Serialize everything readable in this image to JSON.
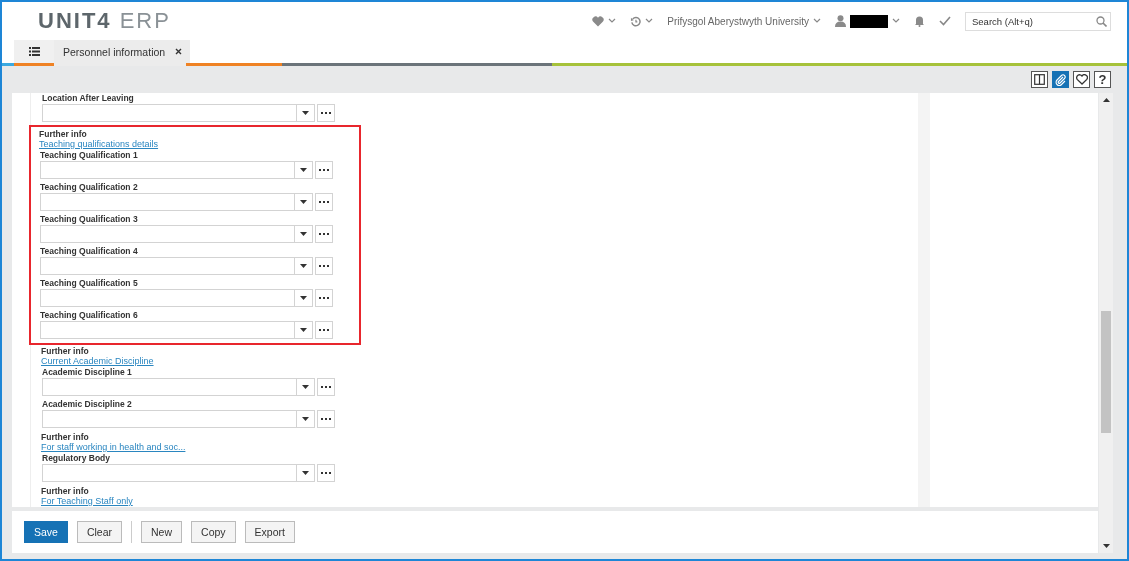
{
  "header": {
    "logo_brand": "UNIT4",
    "logo_product": "ERP",
    "organisation": "Prifysgol Aberystwyth University",
    "search": {
      "placeholder": "Search (Alt+q)"
    }
  },
  "tabs": [
    {
      "label": "Personnel information",
      "selected": true
    }
  ],
  "toolbar": [
    {
      "kind": "split",
      "selected": false
    },
    {
      "kind": "attach",
      "selected": true
    },
    {
      "kind": "favourite",
      "selected": false
    },
    {
      "kind": "help",
      "label": "?",
      "selected": false
    }
  ],
  "sections": [
    {
      "highlighted": false,
      "items": [
        {
          "kind": "field",
          "label": "Location After Leaving"
        }
      ]
    },
    {
      "highlighted": true,
      "items": [
        {
          "kind": "info",
          "title": "Further info",
          "link": "Teaching qualifications details"
        },
        {
          "kind": "field",
          "label": "Teaching Qualification 1"
        },
        {
          "kind": "field",
          "label": "Teaching Qualification 2"
        },
        {
          "kind": "field",
          "label": "Teaching Qualification 3"
        },
        {
          "kind": "field",
          "label": "Teaching Qualification 4"
        },
        {
          "kind": "field",
          "label": "Teaching Qualification 5"
        },
        {
          "kind": "field",
          "label": "Teaching Qualification 6"
        }
      ]
    },
    {
      "highlighted": false,
      "items": [
        {
          "kind": "info",
          "title": "Further info",
          "link": "Current Academic Discipline"
        },
        {
          "kind": "field",
          "label": "Academic Discipline 1"
        },
        {
          "kind": "field",
          "label": "Academic Discipline 2"
        },
        {
          "kind": "info",
          "title": "Further info",
          "link": "For staff working in health and soc..."
        },
        {
          "kind": "field",
          "label": "Regulatory Body"
        },
        {
          "kind": "info",
          "title": "Further info",
          "link": "For Teaching Staff only"
        }
      ]
    }
  ],
  "buttons": [
    {
      "label": "Save",
      "kind": "primary"
    },
    {
      "label": "Clear",
      "kind": "default"
    },
    {
      "kind": "separator"
    },
    {
      "label": "New",
      "kind": "default"
    },
    {
      "label": "Copy",
      "kind": "default"
    },
    {
      "label": "Export",
      "kind": "default"
    }
  ]
}
